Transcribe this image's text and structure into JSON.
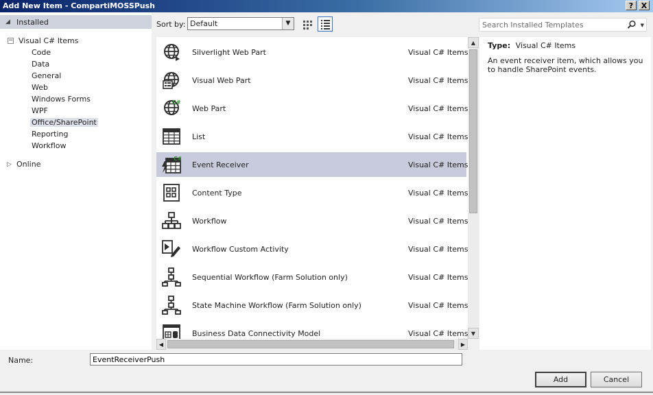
{
  "window": {
    "title": "Add New Item - CompartiMOSSPush",
    "help_label": "?",
    "close_label": "X"
  },
  "sidebar": {
    "installed_label": "Installed",
    "root_label": "Visual C# Items",
    "children": [
      "Code",
      "Data",
      "General",
      "Web",
      "Windows Forms",
      "WPF",
      "Office/SharePoint",
      "Reporting",
      "Workflow"
    ],
    "selected": "Office/SharePoint",
    "online_label": "Online"
  },
  "toolbar": {
    "sort_label": "Sort by:",
    "sort_value": "Default"
  },
  "templates": [
    {
      "name": "Silverlight Web Part",
      "category": "Visual C# Items",
      "icon": "globe-webpart-icon"
    },
    {
      "name": "Visual Web Part",
      "category": "Visual C# Items",
      "icon": "visual-webpart-icon"
    },
    {
      "name": "Web Part",
      "category": "Visual C# Items",
      "icon": "webpart-csharp-icon"
    },
    {
      "name": "List",
      "category": "Visual C# Items",
      "icon": "list-grid-icon"
    },
    {
      "name": "Event Receiver",
      "category": "Visual C# Items",
      "icon": "event-receiver-icon"
    },
    {
      "name": "Content Type",
      "category": "Visual C# Items",
      "icon": "content-type-icon"
    },
    {
      "name": "Workflow",
      "category": "Visual C# Items",
      "icon": "workflow-icon"
    },
    {
      "name": "Workflow Custom Activity",
      "category": "Visual C# Items",
      "icon": "workflow-activity-icon"
    },
    {
      "name": "Sequential Workflow (Farm Solution only)",
      "category": "Visual C# Items",
      "icon": "sequential-workflow-icon"
    },
    {
      "name": "State Machine Workflow (Farm Solution only)",
      "category": "Visual C# Items",
      "icon": "state-machine-icon"
    },
    {
      "name": "Business Data Connectivity Model",
      "category": "Visual C# Items",
      "icon": "bdc-model-icon"
    }
  ],
  "selected_template": "Event Receiver",
  "search": {
    "placeholder": "Search Installed Templates"
  },
  "details": {
    "type_label": "Type:",
    "type_value": "Visual C# Items",
    "description": "An event receiver item, which allows you to handle SharePoint events."
  },
  "form": {
    "name_label": "Name:",
    "name_value": "EventReceiverPush"
  },
  "buttons": {
    "add": "Add",
    "cancel": "Cancel"
  }
}
